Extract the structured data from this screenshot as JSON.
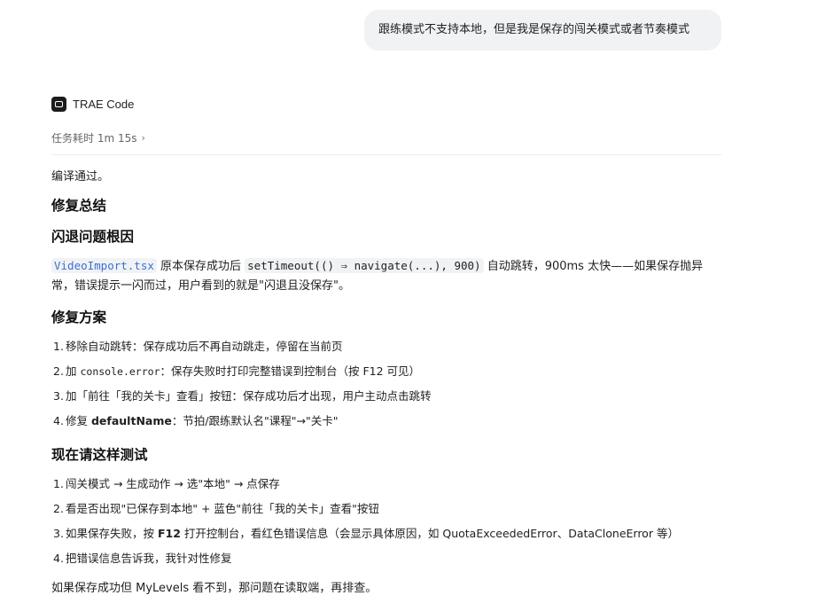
{
  "user_message": {
    "text": "跟练模式不支持本地，但是我是保存的闯关模式或者节奏模式"
  },
  "agent": {
    "icon": "terminal-window-icon",
    "name": "TRAE Code",
    "task_time": "任务耗时 1m 15s",
    "task_time_chevron": "›"
  },
  "response": {
    "compile_status": "编译通过。",
    "heading_summary": "修复总结",
    "heading_root_cause": "闪退问题根因",
    "root_cause": {
      "file": "VideoImport.tsx",
      "text1": " 原本保存成功后 ",
      "code": "setTimeout(() ⇒ navigate(...), 900)",
      "text2": " 自动跳转，900ms 太快——如果保存抛异常，错误提示一闪而过，用户看到的就是\"闪退且没保存\"。"
    },
    "heading_plan": "修复方案",
    "plan": [
      {
        "num": "1.",
        "a": "移除自动跳转：保存成功后不再自动跳走，停留在当前页",
        "code": "",
        "bold": "",
        "b": ""
      },
      {
        "num": "2.",
        "a": "加 ",
        "code": "console.error",
        "bold": "",
        "b": "：保存失败时打印完整错误到控制台（按 F12 可见）"
      },
      {
        "num": "3.",
        "a": "加「前往「我的关卡」查看」按钮：保存成功后才出现，用户主动点击跳转",
        "code": "",
        "bold": "",
        "b": ""
      },
      {
        "num": "4.",
        "a": "修复 ",
        "code": "",
        "bold": "defaultName",
        "b": "：节拍/跟练默认名\"课程\"→\"关卡\""
      }
    ],
    "heading_test": "现在请这样测试",
    "test": [
      {
        "num": "1.",
        "a": "闯关模式 → 生成动作 → 选\"本地\" → 点保存",
        "bold": "",
        "b": ""
      },
      {
        "num": "2.",
        "a": "看是否出现\"已保存到本地\" + 蓝色\"前往「我的关卡」查看\"按钮",
        "bold": "",
        "b": ""
      },
      {
        "num": "3.",
        "a": "如果保存失败，按 ",
        "bold": "F12",
        "b": " 打开控制台，看红色错误信息（会显示具体原因，如 QuotaExceededError、DataCloneError 等）"
      },
      {
        "num": "4.",
        "a": "把错误信息告诉我，我针对性修复",
        "bold": "",
        "b": ""
      }
    ],
    "final_note": "如果保存成功但 MyLevels 看不到，那问题在读取端，再排查。"
  }
}
